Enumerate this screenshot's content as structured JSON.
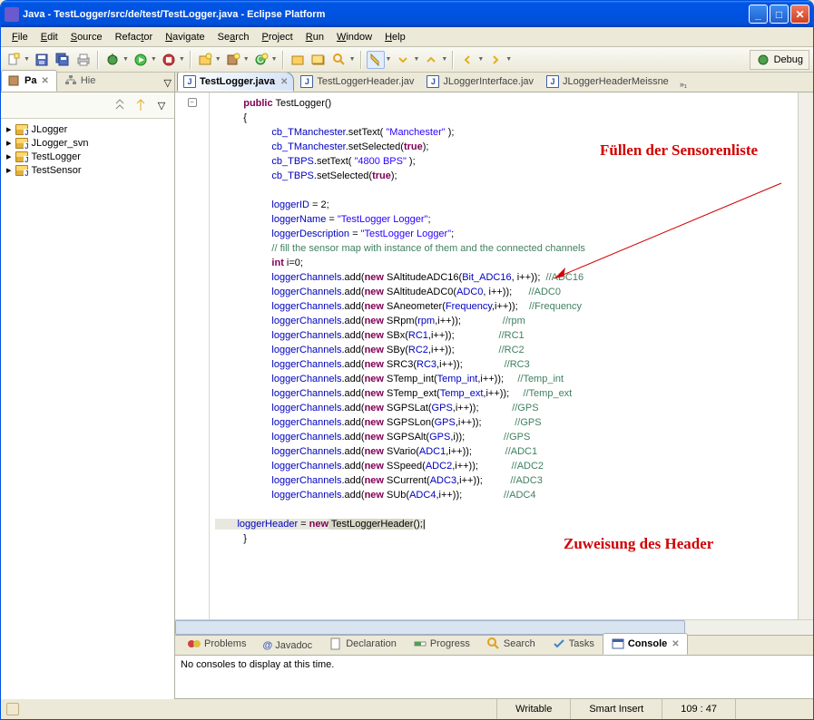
{
  "window": {
    "title": "Java - TestLogger/src/de/test/TestLogger.java - Eclipse Platform"
  },
  "menu": {
    "file": "File",
    "edit": "Edit",
    "source": "Source",
    "refactor": "Refactor",
    "navigate": "Navigate",
    "search": "Search",
    "project": "Project",
    "run": "Run",
    "window": "Window",
    "help": "Help"
  },
  "perspective": {
    "debug": "Debug"
  },
  "leftpanel": {
    "tab_package": "Pa",
    "tab_hierarchy": "Hie",
    "projects": [
      "JLogger",
      "JLogger_svn",
      "TestLogger",
      "TestSensor"
    ]
  },
  "editor_tabs": {
    "t0": "TestLogger.java",
    "t1": "TestLoggerHeader.jav",
    "t2": "JLoggerInterface.jav",
    "t3": "JLoggerHeaderMeissne",
    "more": "»₁"
  },
  "annotations": {
    "fill": "Füllen der Sensorenliste",
    "assign": "Zuweisung des Header"
  },
  "bottom_tabs": {
    "problems": "Problems",
    "javadoc": "Javadoc",
    "declaration": "Declaration",
    "progress": "Progress",
    "search": "Search",
    "tasks": "Tasks",
    "console": "Console"
  },
  "console_msg": "No consoles to display at this time.",
  "status": {
    "writable": "Writable",
    "insert": "Smart Insert",
    "pos": "109 : 47"
  },
  "code": {
    "sig": "public",
    "ctor": " TestLogger()",
    "obr": "{",
    "l1a": "cb_TManchester",
    "l1b": ".setText( ",
    "l1c": "\"Manchester\"",
    "l1d": " );",
    "l2a": "cb_TManchester",
    "l2b": ".setSelected(",
    "l2c": "true",
    "l2d": ");",
    "l3a": "cb_TBPS",
    "l3b": ".setText( ",
    "l3c": "\"4800 BPS\"",
    "l3d": " );",
    "l4a": "cb_TBPS",
    "l4b": ".setSelected(",
    "l4c": "true",
    "l4d": ");",
    "l5a": "loggerID",
    "l5b": " = 2;",
    "l6a": "loggerName",
    "l6b": " = ",
    "l6c": "\"TestLogger Logger\"",
    "l6d": ";",
    "l7a": "loggerDescription",
    "l7b": " = ",
    "l7c": "\"TestLogger Logger\"",
    "l7d": ";",
    "l8": "// fill the sensor map with instance of them and the connected channels",
    "l9a": "int",
    "l9b": " i=0;",
    "ch": "loggerChannels",
    "add": ".add(",
    "nw": "new",
    "s1": " SAltitudeADC16(",
    "p1": "Bit_ADC16",
    "e1": ", i++));  ",
    "c1": "//ADC16",
    "s2": " SAltitudeADC0(",
    "p2": "ADC0",
    "e2": ", i++));      ",
    "c2": "//ADC0",
    "s3": " SAneometer(",
    "p3": "Frequency",
    "e3": ",i++));    ",
    "c3": "//Frequency",
    "s4": " SRpm(",
    "p4": "rpm",
    "e4": ",i++));               ",
    "c4": "//rpm",
    "s5": " SBx(",
    "p5": "RC1",
    "e5": ",i++));                ",
    "c5": "//RC1",
    "s6": " SBy(",
    "p6": "RC2",
    "e6": ",i++));                ",
    "c6": "//RC2",
    "s7": " SRC3(",
    "p7": "RC3",
    "e7": ",i++));               ",
    "c7": "//RC3",
    "s8": " STemp_int(",
    "p8": "Temp_int",
    "e8": ",i++));     ",
    "c8": "//Temp_int",
    "s9": " STemp_ext(",
    "p9": "Temp_ext",
    "e9": ",i++));     ",
    "c9": "//Temp_ext",
    "s10": " SGPSLat(",
    "p10": "GPS",
    "e10": ",i++));            ",
    "c10": "//GPS",
    "s11": " SGPSLon(",
    "p11": "GPS",
    "e11": ",i++));            ",
    "c11": "//GPS",
    "s12": " SGPSAlt(",
    "p12": "GPS",
    "e12": ",i));              ",
    "c12": "//GPS",
    "s13": " SVario(",
    "p13": "ADC1",
    "e13": ",i++));            ",
    "c13": "//ADC1",
    "s14": " SSpeed(",
    "p14": "ADC2",
    "e14": ",i++));            ",
    "c14": "//ADC2",
    "s15": " SCurrent(",
    "p15": "ADC3",
    "e15": ",i++));          ",
    "c15": "//ADC3",
    "s16": " SUb(",
    "p16": "ADC4",
    "e16": ",i++));               ",
    "c16": "//ADC4",
    "lh": "loggerHeader",
    "lheq": " = ",
    "lhnew": "new",
    "lhtype": " TestLoggerHeader",
    "lhend": "();",
    "cbr": "}"
  }
}
